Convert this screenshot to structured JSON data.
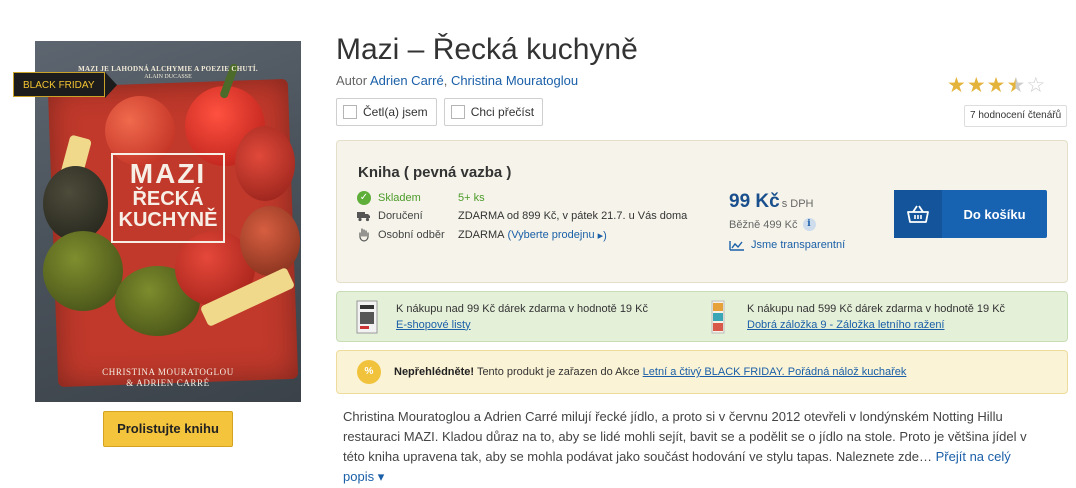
{
  "cover": {
    "tagline": "Mazi je lahodná alchymie a poezie chutí.",
    "tagline_author": "Alain Ducasse",
    "title_line1": "MAZI",
    "title_line2": "ŘECKÁ",
    "title_line3": "KUCHYNĚ",
    "authors_line1": "CHRISTINA MOURATOGLOU",
    "authors_line2": "& ADRIEN CARRÉ",
    "badge": "BLACK FRIDAY"
  },
  "browse_button": "Prolistujte knihu",
  "title": "Mazi – Řecká kuchyně",
  "author_label": "Autor",
  "authors": [
    "Adrien Carré",
    "Christina Mouratoglou"
  ],
  "author_separator": ",",
  "checkboxes": {
    "read": "Četl(a) jsem",
    "want": "Chci přečíst"
  },
  "rating": {
    "stars": 3.5,
    "max": 5,
    "count_label": "7 hodnocení čtenářů"
  },
  "purchase": {
    "format": "Kniha ( pevná vazba )",
    "stock_label": "Skladem",
    "stock_value": "5+ ks",
    "delivery_label": "Doručení",
    "delivery_value": "ZDARMA od 899 Kč, v pátek 21.7. u Vás doma",
    "pickup_label": "Osobní odběr",
    "pickup_value": "ZDARMA",
    "pickup_link": "Vyberte prodejnu",
    "price": "99 Kč",
    "price_note": "s DPH",
    "regular_price": "Běžně 499 Kč",
    "transparent": "Jsme transparentní",
    "cart_button": "Do košíku"
  },
  "gifts": [
    {
      "text": "K nákupu nad 99 Kč dárek zdarma v hodnotě 19 Kč",
      "link": "E-shopové listy"
    },
    {
      "text": "K nákupu nad 599 Kč dárek zdarma v hodnotě 19 Kč",
      "link": "Dobrá záložka 9 - Záložka letního ražení"
    }
  ],
  "notice": {
    "bold": "Nepřehlédněte!",
    "text": "Tento produkt je zařazen do Akce",
    "link": "Letní a čtivý BLACK FRIDAY. Pořádná nálož kuchařek",
    "badge": "%"
  },
  "description": {
    "text": "Christina Mouratoglou a Adrien Carré milují řecké jídlo, a proto si v červnu 2012 otevřeli v londýnském Notting Hillu restauraci MAZI. Kladou důraz na to, aby se lidé mohli sejít, bavit se a podělit se o jídlo na stole. Proto je většina jídel v této kniha upravena tak, aby se mohla podávat jako součást hodování ve stylu tapas. Naleznete zde…",
    "more": "Přejít na celý popis"
  },
  "colors": {
    "accent_blue": "#1862b2",
    "stock_green": "#4c9a2a",
    "star_gold": "#e3b33b",
    "badge_gold": "#f4c430"
  }
}
